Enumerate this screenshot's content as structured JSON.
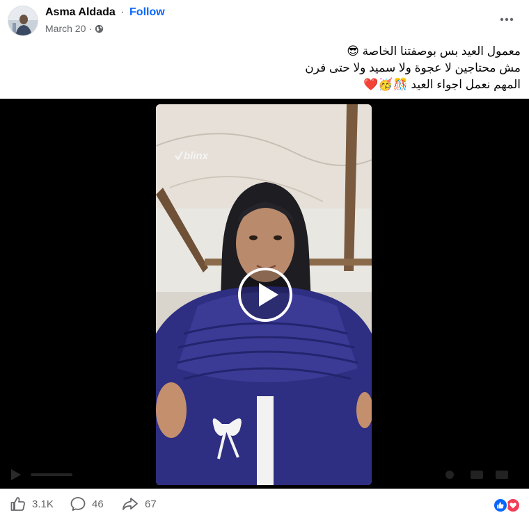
{
  "post": {
    "author": "Asma Aldada",
    "separator": "·",
    "follow_label": "Follow",
    "date": "March 20",
    "date_separator": "·",
    "privacy_icon": "globe-icon",
    "menu_icon": "more-horizontal-icon"
  },
  "caption": {
    "line1": "معمول العيد بس بوصفتنا الخاصة 😎",
    "line2": "مش محتاجين لا عجوة ولا سميد ولا حتى فرن",
    "line3": "المهم نعمل اجواء العيد 🎊🥳❤️"
  },
  "video": {
    "watermark": "blinx",
    "play_icon": "play-icon"
  },
  "footer": {
    "likes": "3.1K",
    "comments": "46",
    "shares": "67",
    "reaction_icons": [
      "like-reaction-icon",
      "love-reaction-icon"
    ],
    "colors": {
      "like": "#0866ff",
      "love": "#f33e58"
    }
  }
}
